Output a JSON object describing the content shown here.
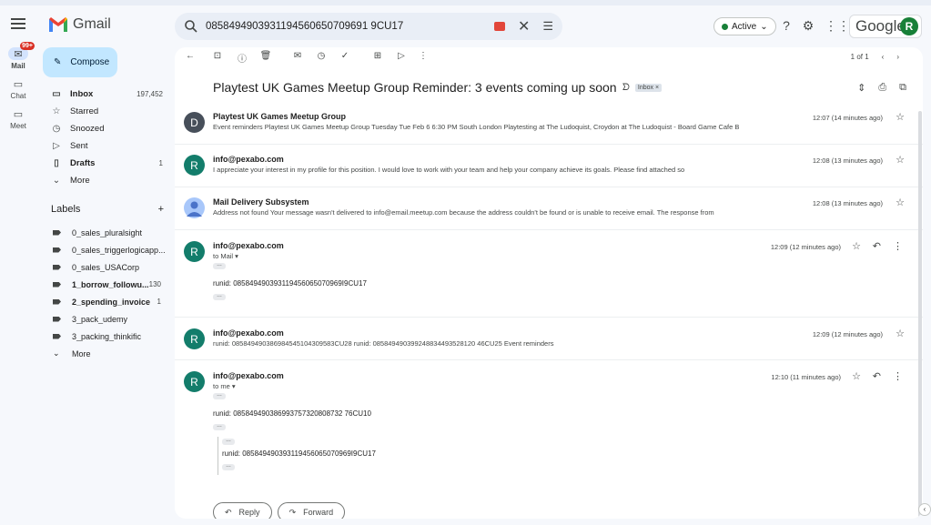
{
  "app": {
    "name": "Gmail",
    "brand_color": "#ea4335"
  },
  "search": {
    "value": "0858494903931194560650709691 9CU17"
  },
  "header": {
    "status": "Active",
    "google_label": "Google",
    "avatar_initial": "R"
  },
  "rail": [
    {
      "label": "Mail",
      "icon": "mail-icon",
      "badge": "99+"
    },
    {
      "label": "Chat",
      "icon": "chat-icon"
    },
    {
      "label": "Meet",
      "icon": "meet-icon"
    }
  ],
  "compose": {
    "label": "Compose"
  },
  "nav": [
    {
      "label": "Inbox",
      "count": "197,452",
      "icon": "inbox-icon",
      "bold": true
    },
    {
      "label": "Starred",
      "count": "",
      "icon": "star-icon"
    },
    {
      "label": "Snoozed",
      "count": "",
      "icon": "clock-icon"
    },
    {
      "label": "Sent",
      "count": "",
      "icon": "send-icon"
    },
    {
      "label": "Drafts",
      "count": "1",
      "icon": "draft-icon",
      "bold": true
    },
    {
      "label": "More",
      "count": "",
      "icon": "chevron-down-icon"
    }
  ],
  "labels": {
    "heading": "Labels",
    "items": [
      {
        "label": "0_sales_pluralsight",
        "count": ""
      },
      {
        "label": "0_sales_triggerlogicapp...",
        "count": ""
      },
      {
        "label": "0_sales_USACorp",
        "count": ""
      },
      {
        "label": "1_borrow_followu...",
        "count": "130",
        "bold": true
      },
      {
        "label": "2_spending_invoice",
        "count": "1",
        "bold": true
      },
      {
        "label": "3_pack_udemy",
        "count": ""
      },
      {
        "label": "3_packing_thinkific",
        "count": ""
      },
      {
        "label": "More",
        "count": ""
      }
    ]
  },
  "toolbar": {
    "pager": "1 of 1"
  },
  "thread": {
    "subject": "Playtest UK Games Meetup Group Reminder: 3 events coming up soon",
    "chip": "Inbox ×",
    "messages": [
      {
        "initial": "D",
        "avatar_color": "#474f5a",
        "sender": "Playtest UK Games Meetup Group",
        "snippet": "Event reminders Playtest UK Games Meetup Group Tuesday Tue Feb 6 6:30 PM South London Playtesting at The Ludoquist, Croydon at The Ludoquist - Board Game Cafe B",
        "time": "12:07 (14 minutes ago)"
      },
      {
        "initial": "R",
        "avatar_color": "#137d6b",
        "sender": "info@pexabo.com",
        "snippet": "I appreciate your interest in my profile for this position. I would love to work with your team and help your company achieve its goals. Please find attached so",
        "time": "12:08 (13 minutes ago)"
      },
      {
        "initial": "",
        "avatar_color": "#a8c7fa",
        "sender": "Mail Delivery Subsystem",
        "snippet": "Address not found Your message wasn't delivered to info@email.meetup.com because the address couldn't be found or is unable to receive email. The response from",
        "time": "12:08 (13 minutes ago)"
      },
      {
        "initial": "R",
        "avatar_color": "#137d6b",
        "sender": "info@pexabo.com",
        "to": "to Mail ▾",
        "body": "runid: 085849490393119456065070969I9CU17",
        "time": "12:09 (12 minutes ago)"
      },
      {
        "initial": "R",
        "avatar_color": "#137d6b",
        "sender": "info@pexabo.com",
        "snippet": "runid: 085849490386984545104309583CU28 runid: 085849490399248834493528120 46CU25 Event reminders",
        "time": "12:09 (12 minutes ago)"
      },
      {
        "initial": "R",
        "avatar_color": "#137d6b",
        "sender": "info@pexabo.com",
        "to": "to me ▾",
        "body": "runid: 085849490386993757320808732 76CU10",
        "quote": "runid: 085849490393119456065070969I9CU17",
        "time": "12:10 (11 minutes ago)"
      }
    ]
  },
  "actions": {
    "reply": "Reply",
    "forward": "Forward"
  }
}
